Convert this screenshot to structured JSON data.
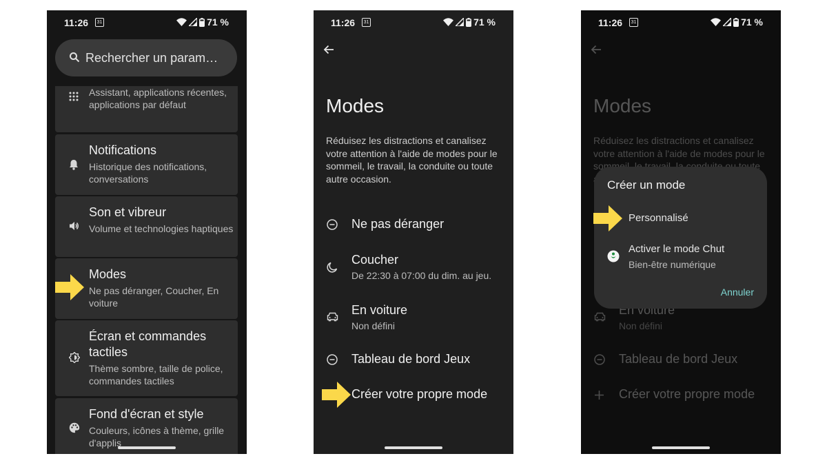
{
  "colors": {
    "arrow": "#fbd84a",
    "accent": "#7fd4d0",
    "background": "#1c1c1c"
  },
  "status_bar": {
    "time": "11:26",
    "calendar_day": "31",
    "battery": "71 %"
  },
  "screen1": {
    "search_placeholder": "Rechercher un param…",
    "items": [
      {
        "title": "",
        "subtitle": "Assistant, applications récentes, applications par défaut",
        "icon": "apps-grid-icon"
      },
      {
        "title": "Notifications",
        "subtitle": "Historique des notifications, conversations",
        "icon": "bell-icon"
      },
      {
        "title": "Son et vibreur",
        "subtitle": "Volume et technologies haptiques",
        "icon": "speaker-icon"
      },
      {
        "title": "Modes",
        "subtitle": "Ne pas déranger, Coucher, En voiture",
        "icon": "modes-icon"
      },
      {
        "title": "Écran et commandes tactiles",
        "subtitle": "Thème sombre, taille de police, commandes tactiles",
        "icon": "brightness-icon"
      },
      {
        "title": "Fond d'écran et style",
        "subtitle": "Couleurs, icônes à thème, grille d'applis",
        "icon": "palette-icon"
      }
    ]
  },
  "screen2": {
    "title": "Modes",
    "description": "Réduisez les distractions et canalisez votre attention à l'aide de modes pour le sommeil, le travail, la conduite ou toute autre occasion.",
    "modes": [
      {
        "title": "Ne pas déranger",
        "subtitle": "",
        "icon": "dnd-icon"
      },
      {
        "title": "Coucher",
        "subtitle": "De 22:30 à 07:00 du dim. au jeu.",
        "icon": "moon-icon"
      },
      {
        "title": "En voiture",
        "subtitle": "Non défini",
        "icon": "car-icon"
      },
      {
        "title": "Tableau de bord Jeux",
        "subtitle": "",
        "icon": "dnd-icon"
      },
      {
        "title": "Créer votre propre mode",
        "subtitle": "",
        "icon": "plus-icon"
      }
    ]
  },
  "screen3": {
    "dialog": {
      "title": "Créer un mode",
      "option_custom": "Personnalisé",
      "option_chut": "Activer le mode Chut",
      "option_chut_sub": "Bien-être numérique",
      "cancel": "Annuler"
    }
  }
}
